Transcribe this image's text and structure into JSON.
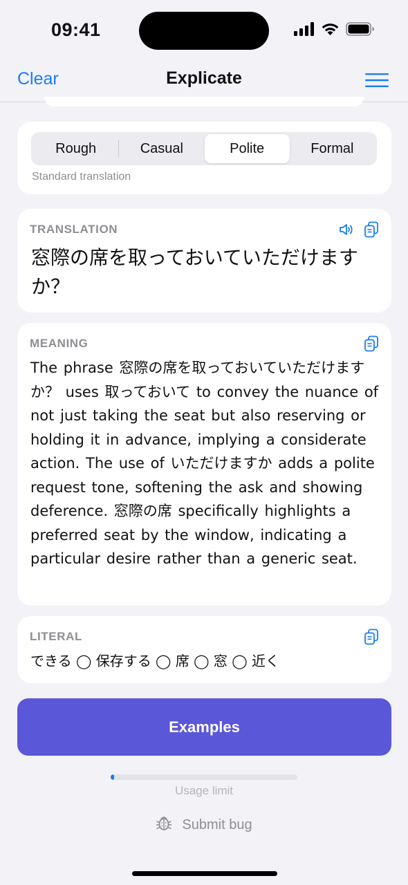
{
  "status_bar": {
    "time": "09:41"
  },
  "nav": {
    "clear_label": "Clear",
    "title": "Explicate"
  },
  "tone": {
    "options": [
      "Rough",
      "Casual",
      "Polite",
      "Formal"
    ],
    "selected": "Polite",
    "description": "Standard translation"
  },
  "translation": {
    "label": "TRANSLATION",
    "text": "窓際の席を取っておいていただけますか？"
  },
  "meaning": {
    "label": "MEANING",
    "text": "The phrase 窓際の席を取っておいていただけますか？ uses 取っておいて to convey the nuance of not just taking the seat but also reserving or holding it in advance, implying a considerate action. The use of いただけますか adds a polite request tone, softening the ask and showing deference. 窓際の席 specifically highlights a preferred seat by the window, indicating a particular desire rather than a generic seat."
  },
  "literal": {
    "label": "LITERAL",
    "text": "できる ◯ 保存する ◯ 席 ◯ 窓 ◯ 近く"
  },
  "examples_label": "Examples",
  "usage": {
    "label": "Usage limit",
    "fraction": 0.02
  },
  "submit_bug_label": "Submit bug",
  "colors": {
    "accent": "#1a7cf5",
    "button": "#5a57d8",
    "background": "#f2f2f7"
  },
  "icons": [
    "cellular-signal-icon",
    "wifi-icon",
    "battery-icon",
    "hamburger-menu-icon",
    "speaker-icon",
    "copy-icon",
    "bug-icon"
  ]
}
